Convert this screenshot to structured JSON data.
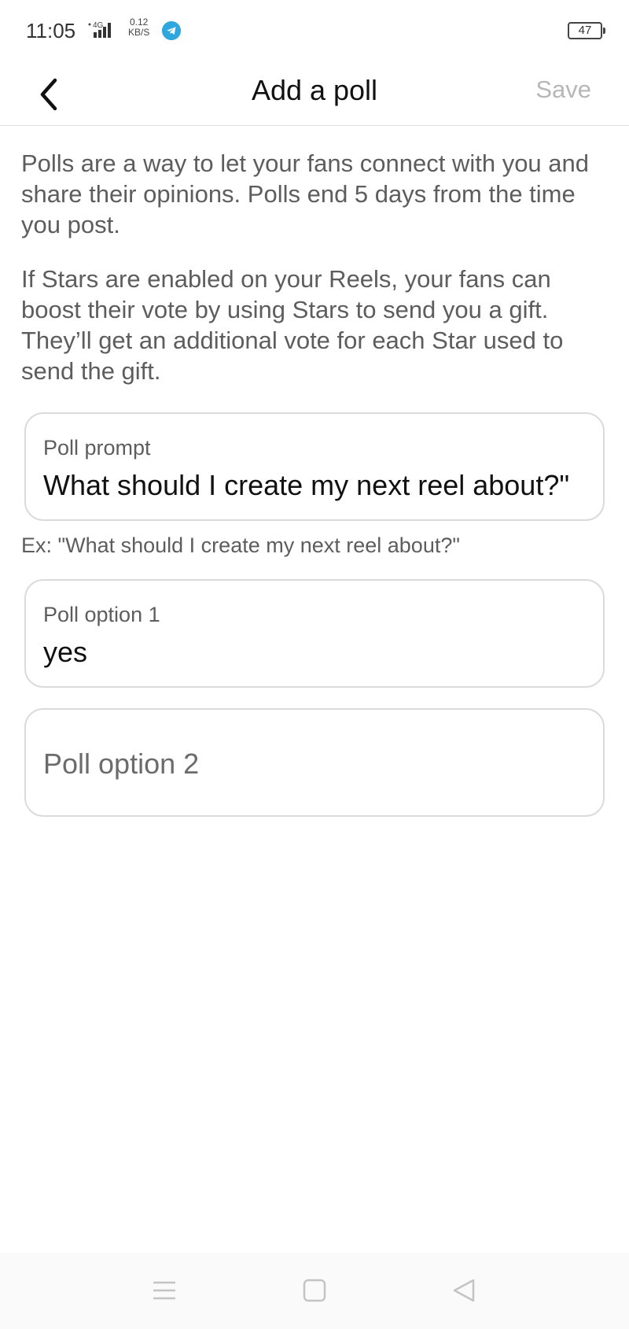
{
  "status_bar": {
    "time": "11:05",
    "network": "4G",
    "speed_value": "0.12",
    "speed_unit": "KB/S",
    "battery": "47"
  },
  "header": {
    "title": "Add a poll",
    "save_label": "Save"
  },
  "description": {
    "paragraph_1": "Polls are a way to let your fans connect with you and share their opinions. Polls end 5 days from the time you post.",
    "paragraph_2": "If Stars are enabled on your Reels, your fans can boost their vote by using Stars to send you a gift. They’ll get an additional vote for each Star used to send the gift."
  },
  "poll_prompt": {
    "label": "Poll prompt",
    "value": "What should I create my next reel about?\"",
    "helper": "Ex: \"What should I create my next reel about?\""
  },
  "poll_option_1": {
    "label": "Poll option 1",
    "value": "yes"
  },
  "poll_option_2": {
    "placeholder": "Poll option 2"
  },
  "colors": {
    "accent_disabled": "#b7b7b7",
    "border": "#dbdbdb",
    "telegram": "#2ea6de"
  },
  "icons": {
    "back": "chevron-left-icon",
    "nav_menu": "menu-icon",
    "nav_home": "home-square-icon",
    "nav_back": "triangle-back-icon"
  }
}
